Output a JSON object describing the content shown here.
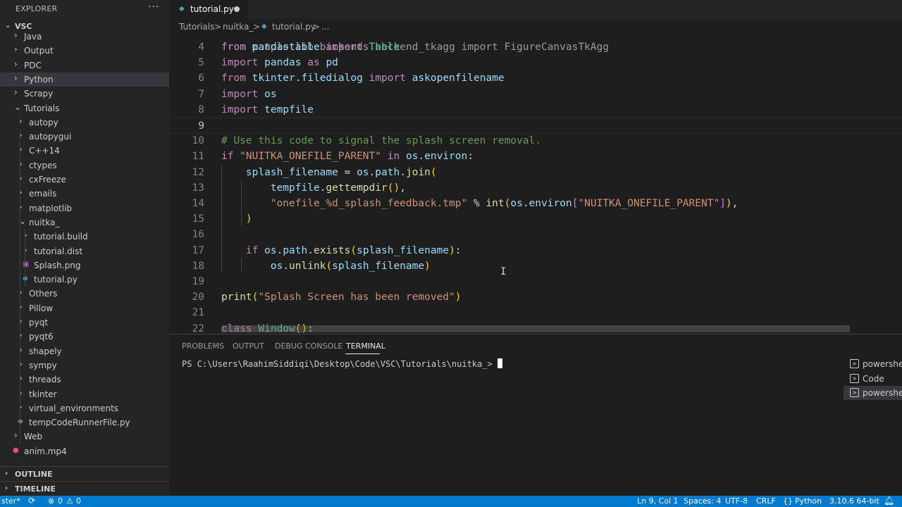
{
  "explorer": {
    "title": "EXPLORER",
    "more": "···",
    "root": "VSC",
    "items": [
      {
        "label": "Java",
        "kind": "folder"
      },
      {
        "label": "Output",
        "kind": "folder"
      },
      {
        "label": "PDC",
        "kind": "folder"
      },
      {
        "label": "Python",
        "kind": "folder",
        "selected": true
      },
      {
        "label": "Scrapy",
        "kind": "folder"
      },
      {
        "label": "Tutorials",
        "kind": "folder-open"
      },
      {
        "label": "autopy",
        "kind": "folder"
      },
      {
        "label": "autopygui",
        "kind": "folder"
      },
      {
        "label": "C++14",
        "kind": "folder"
      },
      {
        "label": "ctypes",
        "kind": "folder"
      },
      {
        "label": "cxFreeze",
        "kind": "folder"
      },
      {
        "label": "emails",
        "kind": "folder"
      },
      {
        "label": "matplotlib",
        "kind": "folder"
      },
      {
        "label": "nuitka_",
        "kind": "folder-open"
      },
      {
        "label": "tutorial.build",
        "kind": "folder"
      },
      {
        "label": "tutorial.dist",
        "kind": "folder"
      },
      {
        "label": "Splash.png",
        "kind": "image-file"
      },
      {
        "label": "tutorial.py",
        "kind": "python-file"
      },
      {
        "label": "Others",
        "kind": "folder"
      },
      {
        "label": "Pillow",
        "kind": "folder"
      },
      {
        "label": "pyqt",
        "kind": "folder"
      },
      {
        "label": "pyqt6",
        "kind": "folder"
      },
      {
        "label": "shapely",
        "kind": "folder"
      },
      {
        "label": "sympy",
        "kind": "folder"
      },
      {
        "label": "threads",
        "kind": "folder"
      },
      {
        "label": "tkinter",
        "kind": "folder"
      },
      {
        "label": "virtual_environments",
        "kind": "folder"
      },
      {
        "label": "tempCodeRunnerFile.py",
        "kind": "python-file"
      },
      {
        "label": "Web",
        "kind": "folder"
      },
      {
        "label": "anim.mp4",
        "kind": "video-file"
      }
    ],
    "outline": "OUTLINE",
    "timeline": "TIMELINE"
  },
  "tab": {
    "label": "tutorial.py"
  },
  "breadcrumb": {
    "items": [
      "Tutorials",
      ">",
      "nuitka_",
      ">",
      "tutorial.py",
      ">",
      "..."
    ]
  },
  "editor": {
    "partial_line": "from matplotlib.backends.backend_tkagg import FigureCanvasTkAgg",
    "lines": [
      {
        "n": "4",
        "code": "from pandastable import Table"
      },
      {
        "n": "5",
        "code": "import pandas as pd"
      },
      {
        "n": "6",
        "code": "from tkinter.filedialog import askopenfilename"
      },
      {
        "n": "7",
        "code": "import os"
      },
      {
        "n": "8",
        "code": "import tempfile"
      },
      {
        "n": "9",
        "code": ""
      },
      {
        "n": "10",
        "code": "# Use this code to signal the splash screen removal."
      },
      {
        "n": "11",
        "code": "if \"NUITKA_ONEFILE_PARENT\" in os.environ:"
      },
      {
        "n": "12",
        "code": "    splash_filename = os.path.join("
      },
      {
        "n": "13",
        "code": "        tempfile.gettempdir(),"
      },
      {
        "n": "14",
        "code": "        \"onefile_%d_splash_feedback.tmp\" % int(os.environ[\"NUITKA_ONEFILE_PARENT\"]),"
      },
      {
        "n": "15",
        "code": "    )"
      },
      {
        "n": "16",
        "code": ""
      },
      {
        "n": "17",
        "code": "    if os.path.exists(splash_filename):"
      },
      {
        "n": "18",
        "code": "        os.unlink(splash_filename)"
      },
      {
        "n": "19",
        "code": ""
      },
      {
        "n": "20",
        "code": "print(\"Splash Screen has been removed\")"
      },
      {
        "n": "21",
        "code": ""
      },
      {
        "n": "22",
        "code": "class Window():"
      }
    ]
  },
  "panel": {
    "tabs": [
      "PROBLEMS",
      "OUTPUT",
      "DEBUG CONSOLE",
      "TERMINAL"
    ],
    "active_tab": "TERMINAL",
    "prompt": "PS C:\\Users\\RaahimSiddiqi\\Desktop\\Code\\VSC\\Tutorials\\nuitka_>",
    "terminals": [
      {
        "label": "powershell",
        "selected": false
      },
      {
        "label": "Code",
        "selected": false
      },
      {
        "label": "powershell",
        "selected": true
      }
    ]
  },
  "status": {
    "branch": "ster*",
    "sync_icon": "sync-icon",
    "errors": "0",
    "warnings": "0",
    "position": "Ln 9, Col 1",
    "spaces": "Spaces: 4",
    "encoding": "UTF-8",
    "eol": "CRLF",
    "language_icon": "{}",
    "language": "Python",
    "interpreter": "3.10.6 64-bit"
  },
  "colors": {
    "accent": "#007acc",
    "keyword": "#c586c0",
    "builtin": "#569cd6",
    "variable": "#9cdcfe",
    "function": "#dcdcaa",
    "class": "#4ec9b0",
    "string": "#ce9178",
    "comment": "#6a9955"
  }
}
